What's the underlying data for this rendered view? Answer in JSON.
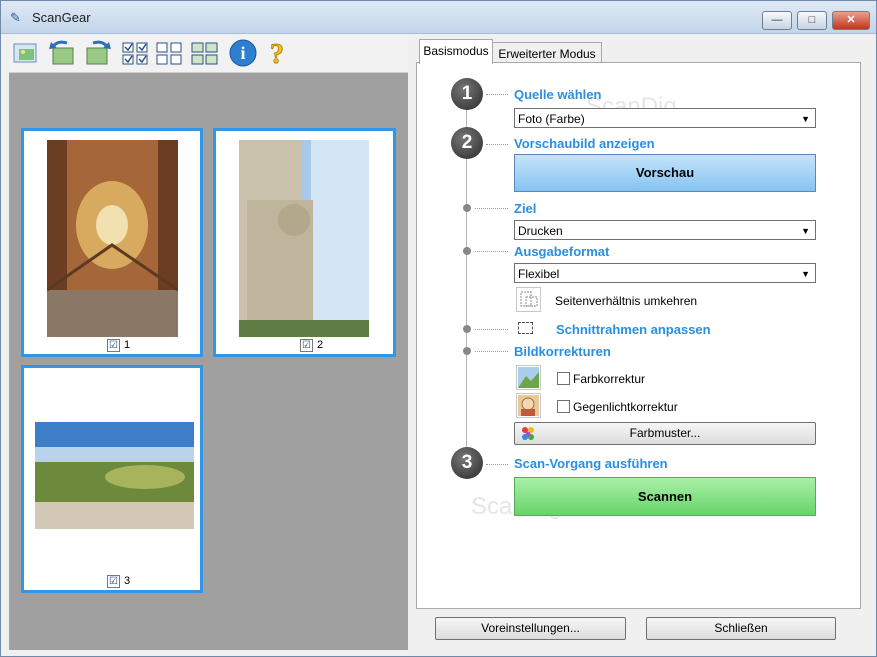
{
  "window": {
    "title": "ScanGear",
    "app_icon": "scanner-icon"
  },
  "title_buttons": {
    "minimize": "—",
    "maximize": "□",
    "close": "✕"
  },
  "toolbar": {
    "icons": [
      "scan-photo-icon",
      "rotate-left-icon",
      "rotate-right-icon",
      "select-all-icon",
      "deselect-all-icon",
      "thumbnail-view-icon",
      "info-icon",
      "help-icon"
    ],
    "info_glyph": "i",
    "help_glyph": "?"
  },
  "thumbnails": [
    {
      "index": "1",
      "checked": true,
      "check": "☑"
    },
    {
      "index": "2",
      "checked": true,
      "check": "☑"
    },
    {
      "index": "3",
      "checked": true,
      "check": "☑"
    }
  ],
  "tabs": [
    {
      "label": "Basismodus",
      "active": true
    },
    {
      "label": "Erweiterter Modus",
      "active": false
    }
  ],
  "watermark": "ScanDig",
  "steps": {
    "step1": {
      "number": "1",
      "heading": "Quelle wählen",
      "select_value": "Foto (Farbe)"
    },
    "step2": {
      "number": "2",
      "heading": "Vorschaubild anzeigen",
      "button": "Vorschau"
    },
    "ziel": {
      "heading": "Ziel",
      "select_value": "Drucken"
    },
    "ausgabe": {
      "heading": "Ausgabeformat",
      "select_value": "Flexibel",
      "swap_label": "Seitenverhältnis umkehren"
    },
    "crop": {
      "label": "Schnittrahmen anpassen"
    },
    "korrektur": {
      "heading": "Bildkorrekturen",
      "farb": {
        "label": "Farbkorrektur",
        "checked": false
      },
      "gegenlicht": {
        "label": "Gegenlichtkorrektur",
        "checked": false
      },
      "pattern_button": "Farbmuster..."
    },
    "step3": {
      "number": "3",
      "heading": "Scan-Vorgang ausführen",
      "button": "Scannen"
    }
  },
  "footer": {
    "preferences": "Voreinstellungen...",
    "close": "Schließen"
  },
  "colors": {
    "accent": "#2a8fe0",
    "selection_border": "#3395e6",
    "preview_bg": "#a0a0a0",
    "scan_button": "#7ee07e",
    "preview_button": "#9fd0f7"
  }
}
